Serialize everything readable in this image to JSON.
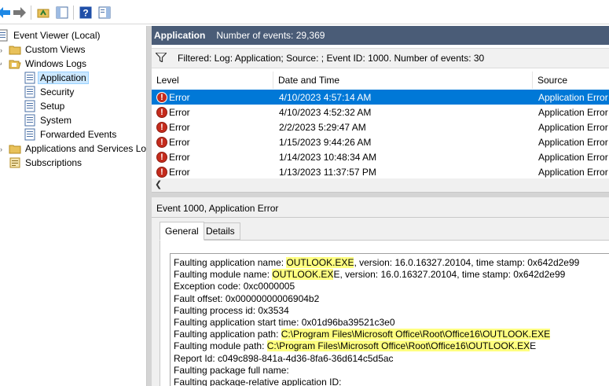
{
  "tree": {
    "root": "Event Viewer (Local)",
    "items": [
      {
        "label": "Custom Views"
      },
      {
        "label": "Windows Logs"
      },
      {
        "label": "Application"
      },
      {
        "label": "Security"
      },
      {
        "label": "Setup"
      },
      {
        "label": "System"
      },
      {
        "label": "Forwarded Events"
      },
      {
        "label": "Applications and Services Lo"
      },
      {
        "label": "Subscriptions"
      }
    ]
  },
  "header": {
    "title": "Application",
    "count": "Number of events: 29,369"
  },
  "filter": {
    "text": "Filtered: Log: Application; Source: ; Event ID: 1000. Number of events: 30"
  },
  "columns": [
    "Level",
    "Date and Time",
    "Source"
  ],
  "events": [
    {
      "level": "Error",
      "datetime": "4/10/2023 4:57:14 AM",
      "source": "Application Error"
    },
    {
      "level": "Error",
      "datetime": "4/10/2023 4:52:32 AM",
      "source": "Application Error"
    },
    {
      "level": "Error",
      "datetime": "2/2/2023 5:29:47 AM",
      "source": "Application Error"
    },
    {
      "level": "Error",
      "datetime": "1/15/2023 9:44:26 AM",
      "source": "Application Error"
    },
    {
      "level": "Error",
      "datetime": "1/14/2023 10:48:34 AM",
      "source": "Application Error"
    },
    {
      "level": "Error",
      "datetime": "1/13/2023 11:37:57 PM",
      "source": "Application Error"
    }
  ],
  "details": {
    "title": "Event 1000, Application Error",
    "tabs": [
      "General",
      "Details"
    ],
    "lines": {
      "l1_pre": "Faulting application name: ",
      "l1_hl": "OUTLOOK.EXE",
      "l1_post": ", version: 16.0.16327.20104, time stamp: 0x642d2e99",
      "l2_pre": "Faulting module name: ",
      "l2_hl": "OUTLOOK.EX",
      "l2_post": "E, version: 16.0.16327.20104, time stamp: 0x642d2e99",
      "l3": "Exception code: 0xc0000005",
      "l4": "Fault offset: 0x00000000006904b2",
      "l5": "Faulting process id: 0x3534",
      "l6": "Faulting application start time: 0x01d96ba39521c3e0",
      "l7_pre": "Faulting application path: ",
      "l7_hl": "C:\\Program Files\\Microsoft Office\\Root\\Office16\\OUTLOOK.EXE",
      "l8_pre": "Faulting module path: ",
      "l8_hl": "C:\\Program Files\\Microsoft Office\\Root\\Office16\\OUTLOOK.EX",
      "l8_post": "E",
      "l9": "Report Id: c049c898-841a-4d36-8fa6-36d614c5d5ac",
      "l10": "Faulting package full name:",
      "l11": "Faulting package-relative application ID:"
    }
  },
  "colors": {
    "header_bg": "#4a5c77",
    "selected_row": "#0078d7",
    "error_red": "#c42b1c",
    "highlight": "#ffff80"
  }
}
